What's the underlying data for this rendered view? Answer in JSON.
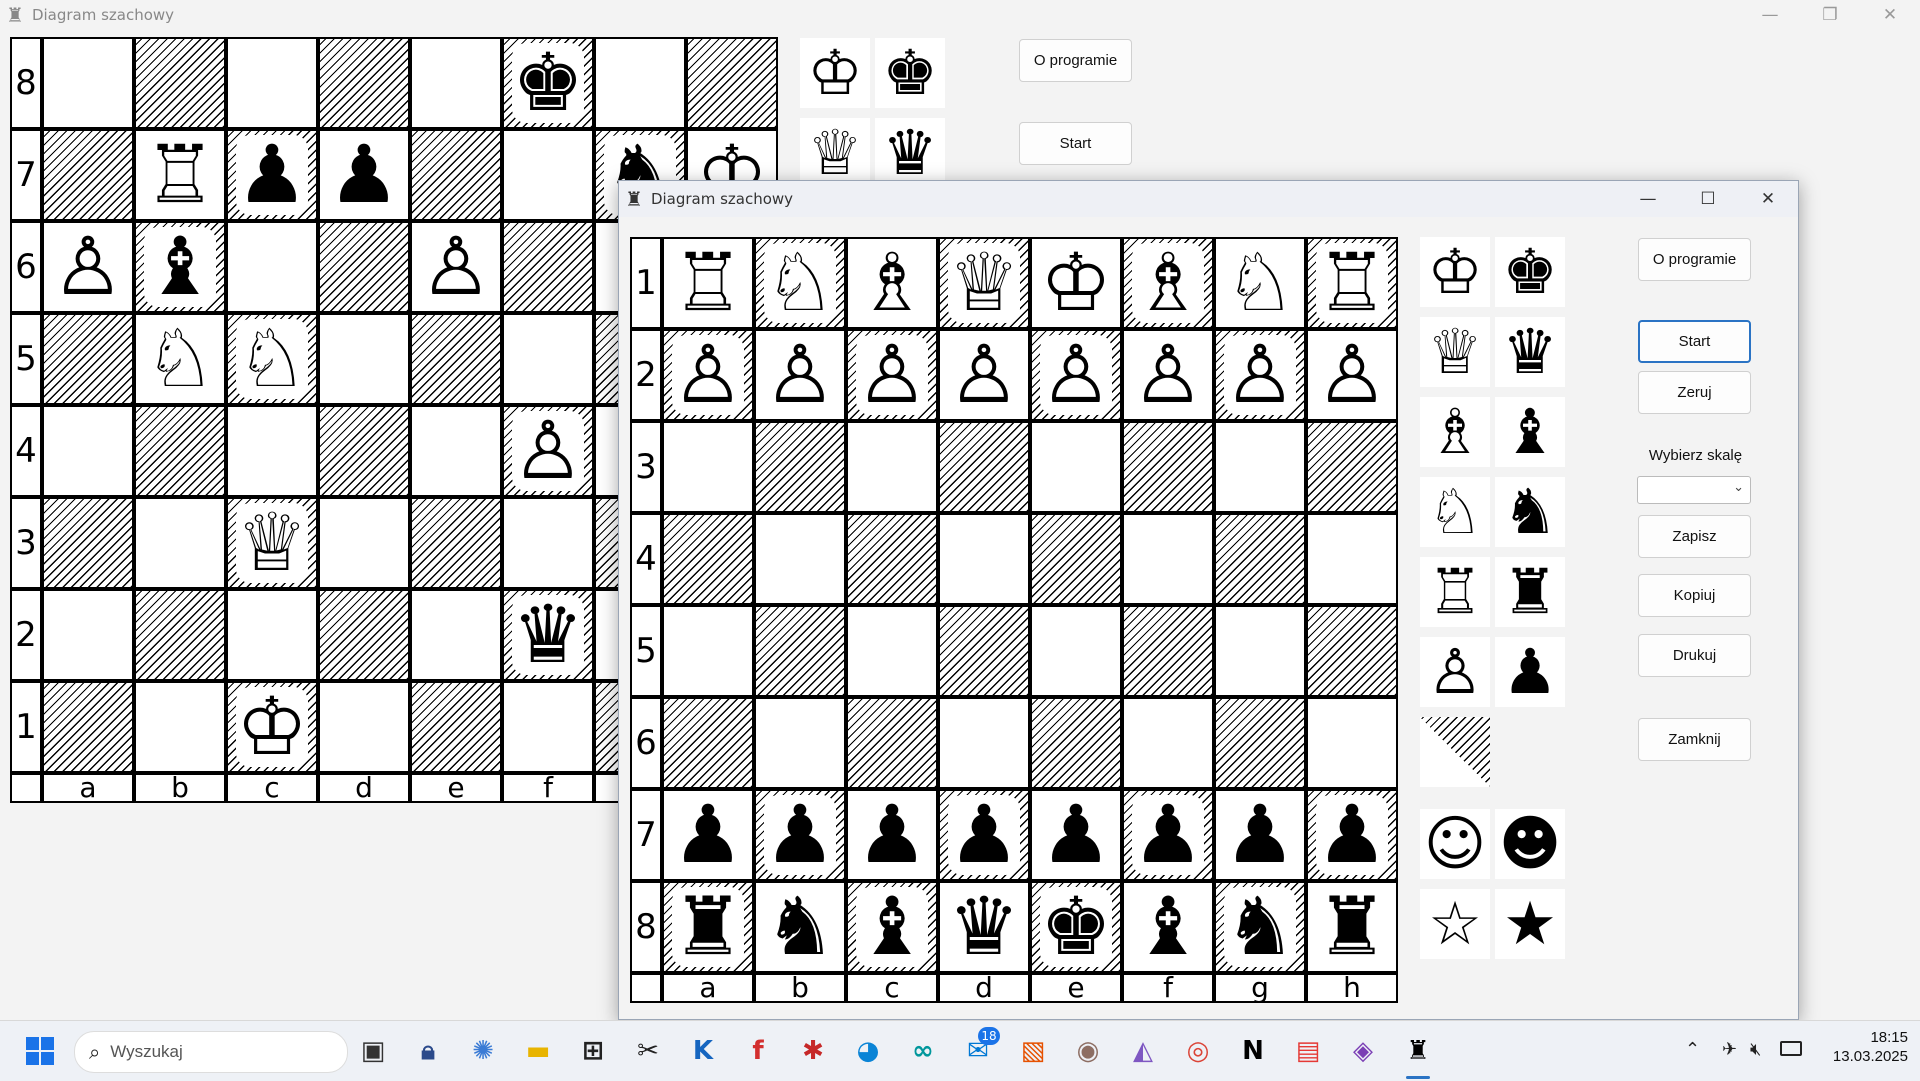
{
  "window_back": {
    "title": "Diagram szachowy",
    "icon": "chess-rook-icon",
    "buttons": {
      "about": "O programie",
      "start": "Start"
    },
    "rank_labels": [
      "8",
      "7",
      "6",
      "5",
      "4",
      "3",
      "2",
      "1"
    ],
    "file_labels": [
      "a",
      "b",
      "c",
      "d",
      "e",
      "f"
    ],
    "board": [
      [
        "",
        "",
        "",
        "",
        "",
        "♚",
        "",
        ""
      ],
      [
        "",
        "♖",
        "♟",
        "♟",
        "",
        "",
        "♞",
        "♔"
      ],
      [
        "♙",
        "♝",
        "",
        "",
        "♙",
        "",
        "",
        ""
      ],
      [
        "",
        "♘",
        "♘",
        "",
        "",
        "",
        "",
        ""
      ],
      [
        "",
        "",
        "",
        "",
        "",
        "♙",
        "",
        ""
      ],
      [
        "",
        "",
        "♕",
        "",
        "",
        "",
        "",
        ""
      ],
      [
        "",
        "",
        "",
        "",
        "",
        "♛",
        "",
        ""
      ],
      [
        "",
        "",
        "♔",
        "",
        "",
        "",
        "",
        ""
      ]
    ],
    "palette": [
      [
        "♔",
        "♚"
      ],
      [
        "♕",
        "♛"
      ]
    ]
  },
  "window_front": {
    "title": "Diagram szachowy",
    "icon": "chess-rook-icon",
    "rank_labels": [
      "1",
      "2",
      "3",
      "4",
      "5",
      "6",
      "7",
      "8"
    ],
    "file_labels": [
      "a",
      "b",
      "c",
      "d",
      "e",
      "f",
      "g",
      "h"
    ],
    "board": [
      [
        "♖",
        "♘",
        "♗",
        "♕",
        "♔",
        "♗",
        "♘",
        "♖"
      ],
      [
        "♙",
        "♙",
        "♙",
        "♙",
        "♙",
        "♙",
        "♙",
        "♙"
      ],
      [
        "",
        "",
        "",
        "",
        "",
        "",
        "",
        ""
      ],
      [
        "",
        "",
        "",
        "",
        "",
        "",
        "",
        ""
      ],
      [
        "",
        "",
        "",
        "",
        "",
        "",
        "",
        ""
      ],
      [
        "",
        "",
        "",
        "",
        "",
        "",
        "",
        ""
      ],
      [
        "♟",
        "♟",
        "♟",
        "♟",
        "♟",
        "♟",
        "♟",
        "♟"
      ],
      [
        "♜",
        "♞",
        "♝",
        "♛",
        "♚",
        "♝",
        "♞",
        "♜"
      ]
    ],
    "palette": [
      [
        "♔",
        "♚"
      ],
      [
        "♕",
        "♛"
      ],
      [
        "♗",
        "♝"
      ],
      [
        "♘",
        "♞"
      ],
      [
        "♖",
        "♜"
      ],
      [
        "♙",
        "♟"
      ]
    ],
    "extras": [
      [
        "☺",
        "☻"
      ],
      [
        "☆",
        "★"
      ]
    ],
    "buttons": {
      "about": "O programie",
      "start": "Start",
      "reset": "Zeruj",
      "scale_label": "Wybierz skalę",
      "scale_value": "",
      "save": "Zapisz",
      "copy": "Kopiuj",
      "print": "Drukuj",
      "close": "Zamknij"
    }
  },
  "taskbar": {
    "search_placeholder": "Wyszukaj",
    "time": "18:15",
    "date": "13.03.2025",
    "badge": "18",
    "apps": [
      "task-view-icon",
      "lock-app-icon",
      "globe-app-icon",
      "file-explorer-icon",
      "calculator-icon",
      "tool-app-icon",
      "ki-app-icon",
      "f-app-icon",
      "puzzle-app-icon",
      "edge-icon",
      "arduino-icon",
      "mail-icon",
      "stripes-app-icon",
      "eye-app-icon",
      "affinity-icon",
      "chrome-icon",
      "notion-icon",
      "pdf-icon",
      "visual-studio-icon",
      "chess-app-icon"
    ]
  },
  "colors": {
    "accent": "#2a73c4",
    "taskbar": "#eef1f6"
  }
}
